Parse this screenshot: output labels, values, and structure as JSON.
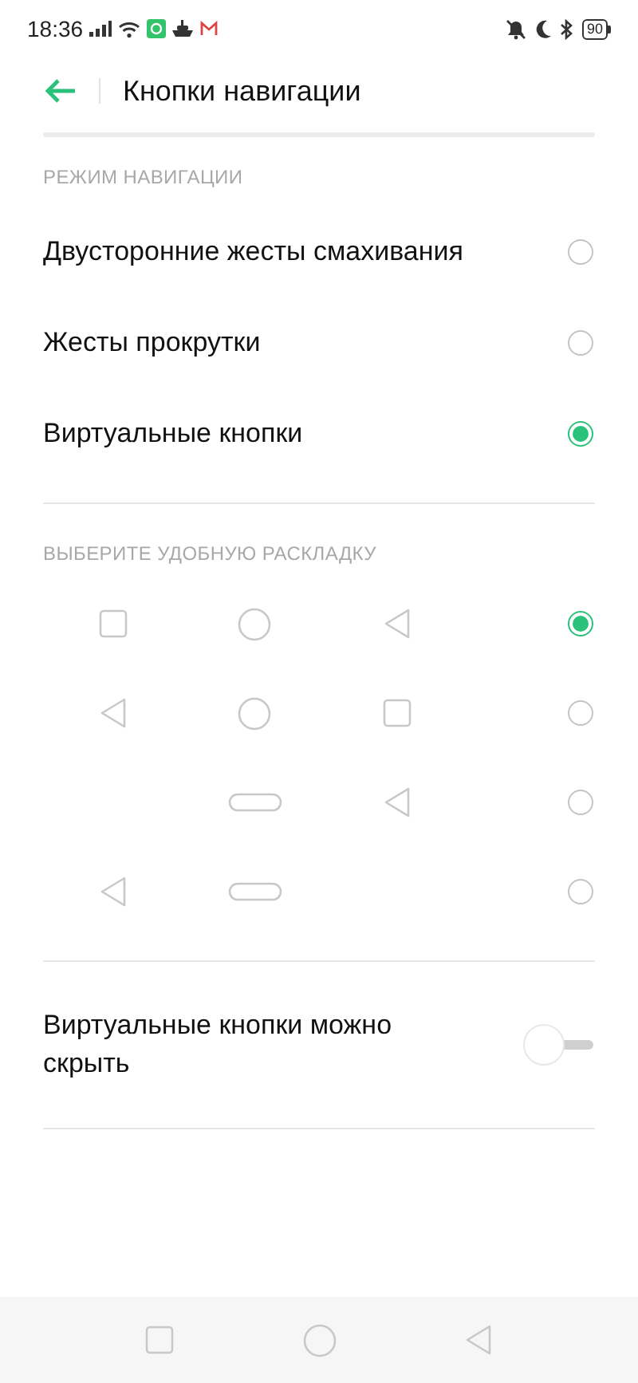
{
  "status_bar": {
    "time": "18:36",
    "battery": "90"
  },
  "header": {
    "title": "Кнопки навигации"
  },
  "nav_mode": {
    "heading": "РЕЖИМ НАВИГАЦИИ",
    "options": [
      {
        "label": "Двусторонние жесты смахивания",
        "selected": false
      },
      {
        "label": "Жесты прокрутки",
        "selected": false
      },
      {
        "label": "Виртуальные кнопки",
        "selected": true
      }
    ]
  },
  "layout": {
    "heading": "ВЫБЕРИТЕ УДОБНУЮ РАСКЛАДКУ",
    "options": [
      {
        "slots": [
          {
            "kind": "square"
          },
          {
            "kind": "circle"
          },
          {
            "kind": "back"
          }
        ],
        "selected": true
      },
      {
        "slots": [
          {
            "kind": "back"
          },
          {
            "kind": "circle"
          },
          {
            "kind": "square"
          }
        ],
        "selected": false
      },
      {
        "slots": [
          {
            "kind": "blank"
          },
          {
            "kind": "pill"
          },
          {
            "kind": "back"
          }
        ],
        "selected": false
      },
      {
        "slots": [
          {
            "kind": "back"
          },
          {
            "kind": "pill"
          },
          {
            "kind": "blank"
          }
        ],
        "selected": false
      }
    ]
  },
  "hide_toggle": {
    "label": "Виртуальные кнопки можно скрыть",
    "on": false
  },
  "nav_bar": [
    {
      "kind": "square"
    },
    {
      "kind": "circle"
    },
    {
      "kind": "back"
    }
  ]
}
